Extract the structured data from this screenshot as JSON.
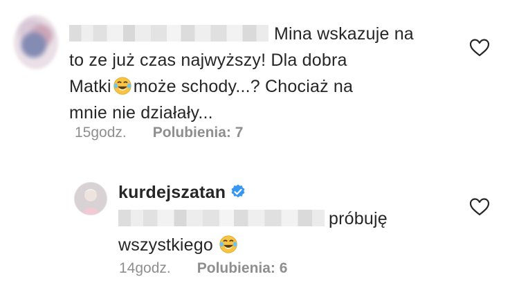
{
  "comments": [
    {
      "text_lines": [
        "Mina wskazuje na",
        "to ze już czas najwyższy! Dla dobra",
        "Matki",
        "może schody...? Chociaż na",
        "mnie nie działały..."
      ],
      "time": "15godz.",
      "likes": "Polubienia: 7",
      "heart_icon": "heart-outline-icon",
      "emoji_icon": "tears-of-joy-emoji-icon"
    },
    {
      "username": "kurdejszatan",
      "verified_icon": "verified-badge-icon",
      "text_lines": [
        "próbuję",
        "wszystkiego"
      ],
      "time": "14godz.",
      "likes": "Polubienia: 6",
      "heart_icon": "heart-outline-icon",
      "emoji_icon": "tears-of-joy-emoji-icon"
    }
  ],
  "colors": {
    "text": "#262626",
    "meta": "#8e8e8e",
    "verified": "#3897f0",
    "emoji_face": "#f7c443"
  }
}
